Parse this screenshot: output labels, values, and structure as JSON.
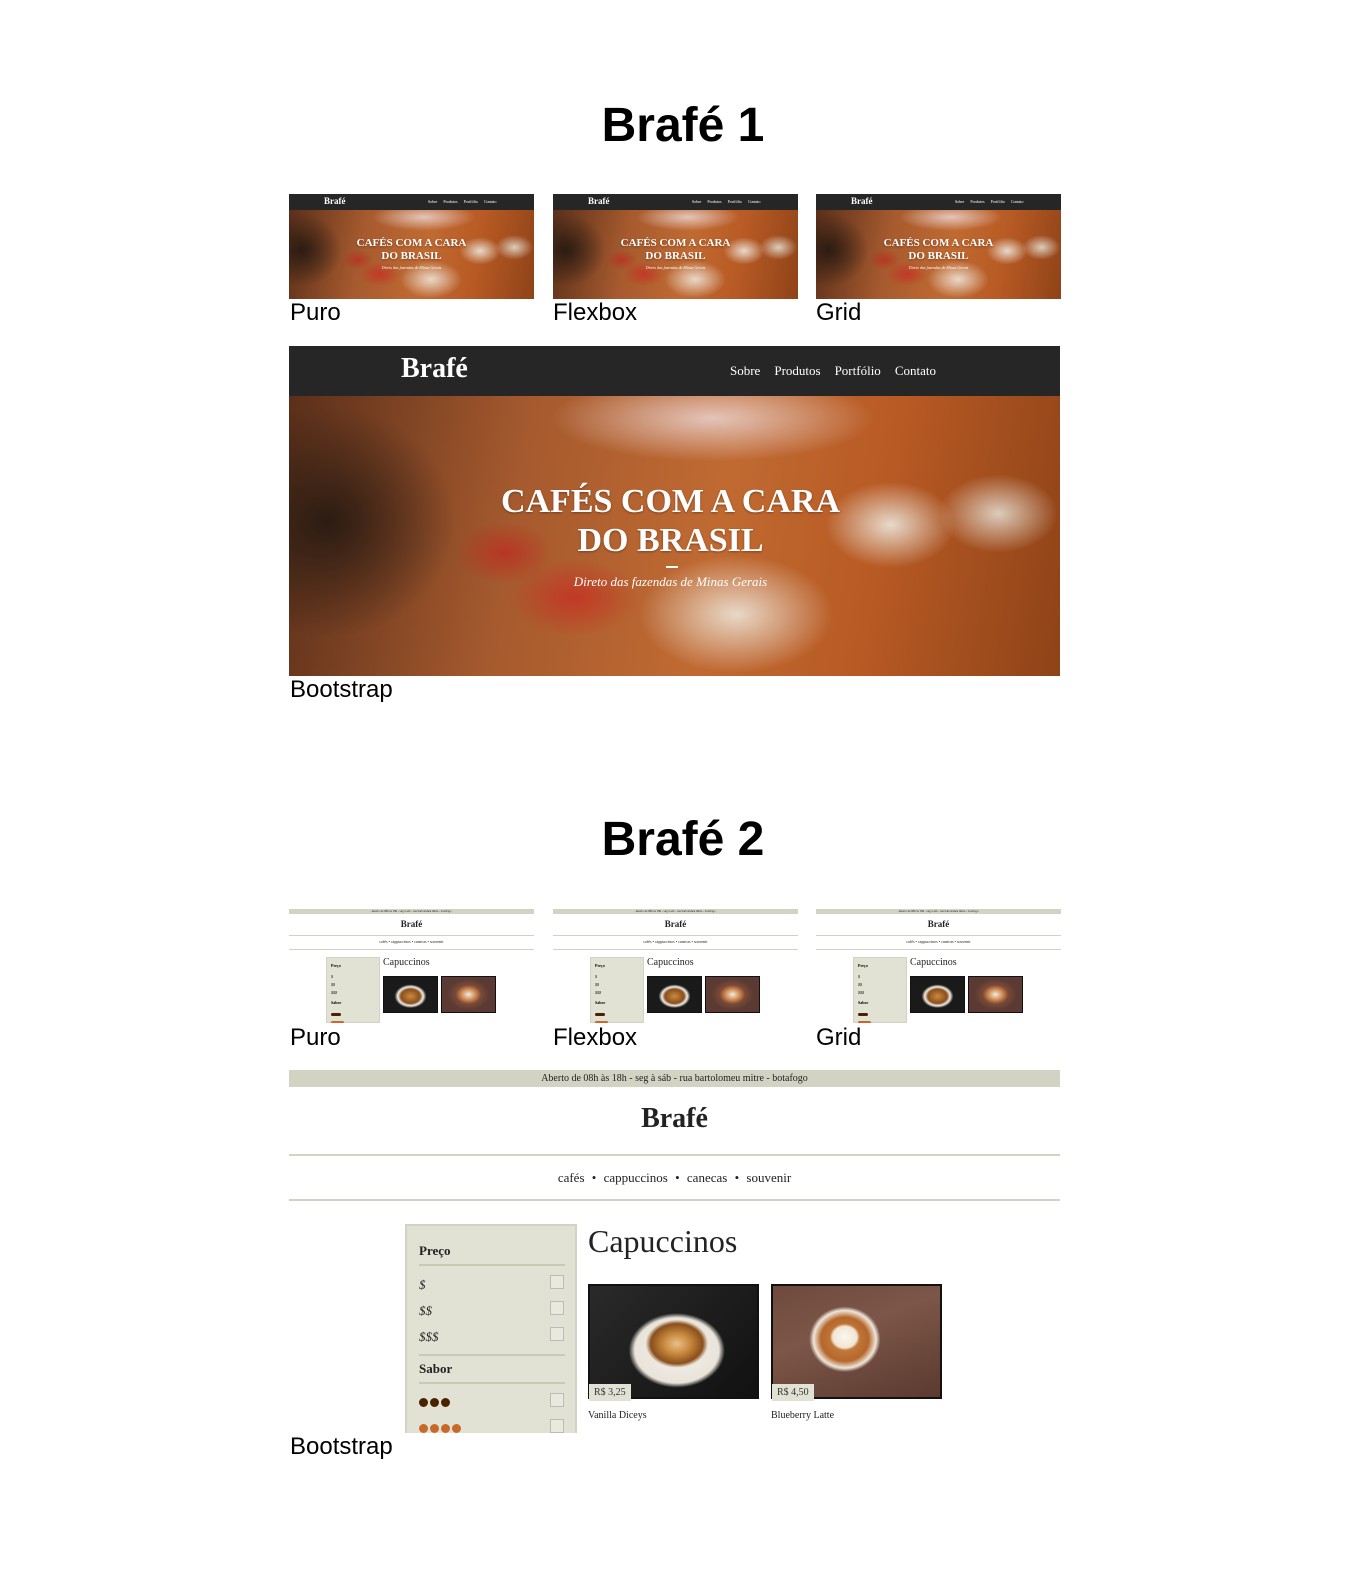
{
  "sections": [
    {
      "title": "Brafé 1"
    },
    {
      "title": "Brafé 2"
    }
  ],
  "captions": {
    "puro": "Puro",
    "flexbox": "Flexbox",
    "grid": "Grid",
    "bootstrap": "Bootstrap"
  },
  "brafe1": {
    "logo": "Brafé",
    "nav": [
      "Sobre",
      "Produtos",
      "Portfólio",
      "Contato"
    ],
    "hero_line1": "CAFÉS COM A CARA",
    "hero_line2": "DO BRASIL",
    "hero_sub": "Direto das fazendas de Minas Gerais"
  },
  "brafe2": {
    "topbar": "Aberto de 08h às 18h - seg à sáb - rua bartolomeu mitre - botafogo",
    "logo": "Brafé",
    "menu": [
      "cafés",
      "cappuccinos",
      "canecas",
      "souvenir"
    ],
    "filter": {
      "price_heading": "Preço",
      "prices": [
        "$",
        "$$",
        "$$$"
      ],
      "flavor_heading": "Sabor"
    },
    "category_title": "Capuccinos",
    "products": [
      {
        "price": "R$ 3,25",
        "name": "Vanilla Diceys"
      },
      {
        "price": "R$ 4,50",
        "name": "Blueberry Latte"
      }
    ]
  },
  "colors": {
    "nav_dark": "#262626",
    "beige": "#d3d3c3",
    "filter_bg": "#e2e2d4",
    "dot_dark": "#4a2200",
    "dot_orange": "#c8692a"
  }
}
